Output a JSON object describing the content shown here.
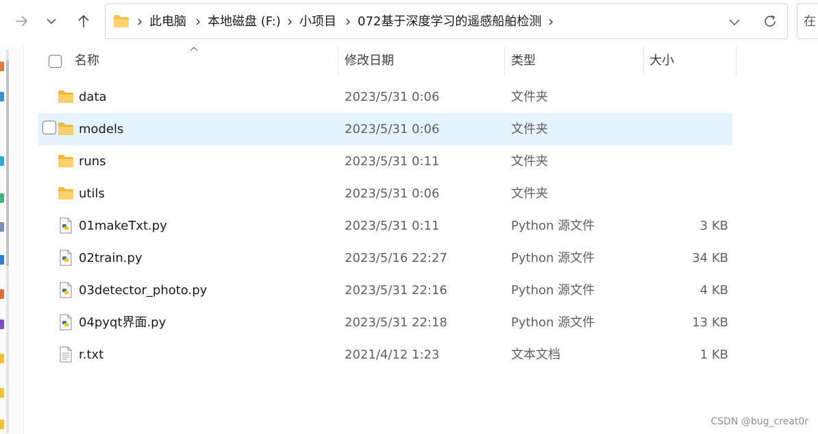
{
  "window": {
    "title": "072基于深度学习的遥感船舶检测"
  },
  "breadcrumbs": [
    "此电脑",
    "本地磁盘 (F:)",
    "小项目",
    "072基于深度学习的遥感船舶检测"
  ],
  "search": {
    "placeholder": "在"
  },
  "columns": {
    "name": "名称",
    "date": "修改日期",
    "type": "类型",
    "size": "大小"
  },
  "files": [
    {
      "name": "data",
      "date": "2023/5/31 0:06",
      "type": "文件夹",
      "size": "",
      "icon": "folder-icon"
    },
    {
      "name": "models",
      "date": "2023/5/31 0:06",
      "type": "文件夹",
      "size": "",
      "icon": "folder-icon"
    },
    {
      "name": "runs",
      "date": "2023/5/31 0:11",
      "type": "文件夹",
      "size": "",
      "icon": "folder-icon"
    },
    {
      "name": "utils",
      "date": "2023/5/31 0:06",
      "type": "文件夹",
      "size": "",
      "icon": "folder-icon"
    },
    {
      "name": "01makeTxt.py",
      "date": "2023/5/31 0:11",
      "type": "Python 源文件",
      "size": "3 KB",
      "icon": "python-file-icon"
    },
    {
      "name": "02train.py",
      "date": "2023/5/16 22:27",
      "type": "Python 源文件",
      "size": "34 KB",
      "icon": "python-file-icon"
    },
    {
      "name": "03detector_photo.py",
      "date": "2023/5/31 22:16",
      "type": "Python 源文件",
      "size": "4 KB",
      "icon": "python-file-icon"
    },
    {
      "name": "04pyqt界面.py",
      "date": "2023/5/31 22:18",
      "type": "Python 源文件",
      "size": "13 KB",
      "icon": "python-file-icon"
    },
    {
      "name": "r.txt",
      "date": "2021/4/12 1:23",
      "type": "文本文档",
      "size": "1 KB",
      "icon": "text-file-icon"
    }
  ],
  "hovered_row": 1,
  "watermark": "CSDN @bug_creat0r",
  "colors": {
    "folder": "#f8c44f",
    "hover": "#e5f3ff",
    "python_blue": "#3a75b0",
    "python_yellow": "#f5c518"
  }
}
